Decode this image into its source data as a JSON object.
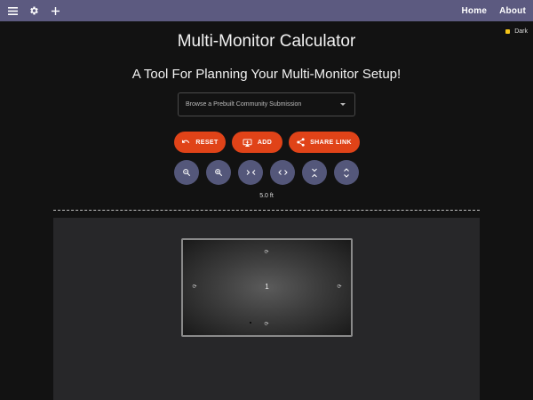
{
  "topbar": {
    "menu_icon": "menu-icon",
    "settings_icon": "gear-icon",
    "add_icon": "plus-icon",
    "home_label": "Home",
    "about_label": "About",
    "background": "#5c5a80"
  },
  "theme_toggle": {
    "label": "Dark",
    "indicator_color": "#f5c518"
  },
  "header": {
    "title": "Multi-Monitor Calculator",
    "subtitle": "A Tool For Planning Your Multi-Monitor Setup!"
  },
  "community_select": {
    "placeholder": "Browse a Prebuilt Community Submission"
  },
  "actions": {
    "reset_label": "RESET",
    "add_label": "ADD",
    "share_label": "SHARE LINK",
    "accent_color": "#e04318"
  },
  "view_controls": {
    "zoom_out_icon": "zoom-out-icon",
    "zoom_in_icon": "zoom-in-icon",
    "shrink_horizontal_icon": "shrink-horizontal-icon",
    "expand_horizontal_icon": "expand-horizontal-icon",
    "shrink_vertical_icon": "shrink-vertical-icon",
    "expand_vertical_icon": "expand-vertical-icon",
    "button_color": "#54577a"
  },
  "scale": {
    "label": "5.0 ft"
  },
  "canvas": {
    "background": "#272729",
    "monitors": [
      {
        "label": "1"
      }
    ]
  }
}
